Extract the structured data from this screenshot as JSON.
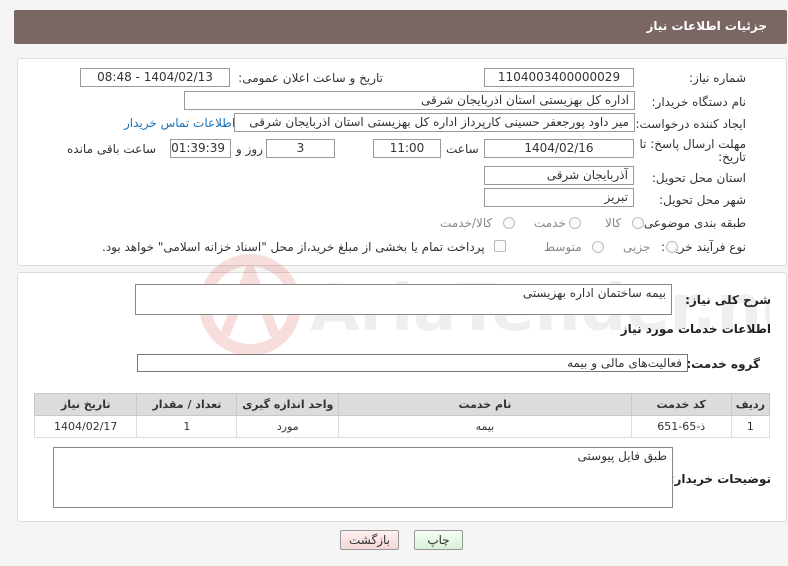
{
  "header": {
    "title": "جزئیات اطلاعات نیاز"
  },
  "form": {
    "need_number": {
      "label": "شماره نیاز:",
      "value": "1104003400000029"
    },
    "announce": {
      "label": "تاریخ و ساعت اعلان عمومی:",
      "value": "1404/02/13 - 08:48"
    },
    "buyer_org": {
      "label": "نام دستگاه خریدار:",
      "value": "اداره کل بهزیستی استان اذربایجان شرقی"
    },
    "requester": {
      "label": "ایجاد کننده درخواست:",
      "value": "میر داود پورجعفر حسینی کارپرداز اداره کل بهزیستی استان اذربایجان شرقی",
      "contact_link": "اطلاعات تماس خریدار"
    },
    "deadline": {
      "label_line1": "مهلت ارسال پاسخ: تا",
      "label_line2": "تاریخ:",
      "date": "1404/02/16",
      "time_label": "ساعت",
      "time": "11:00",
      "days": "3",
      "days_label": "روز و",
      "remaining": "01:39:39",
      "remaining_label": "ساعت باقی مانده"
    },
    "province": {
      "label": "استان محل تحویل:",
      "value": "آذربایجان شرقی"
    },
    "city": {
      "label": "شهر محل تحویل:",
      "value": "تبریز"
    },
    "category": {
      "label": "طبقه بندی موضوعی:",
      "options": [
        "کالا",
        "خدمت",
        "کالا/خدمت"
      ]
    },
    "process": {
      "label": "نوع فرآیند خرید :",
      "options": [
        "جزیی",
        "متوسط"
      ],
      "payment_note": "پرداخت تمام یا بخشی از مبلغ خرید،از محل \"اسناد خزانه اسلامی\" خواهد بود."
    }
  },
  "details": {
    "summary_label": "شرح کلی نیاز:",
    "summary": "بیمه ساختمان اداره بهزیستی",
    "services_heading": "اطلاعات خدمات مورد نیاز",
    "service_group_label": "گروه خدمت:",
    "service_group": "فعالیت‌های مالی و بیمه",
    "table": {
      "headers": [
        "ردیف",
        "کد خدمت",
        "نام خدمت",
        "واحد اندازه گیری",
        "تعداد / مقدار",
        "تاریخ نیاز"
      ],
      "rows": [
        [
          "1",
          "ذ-65-651",
          "بیمه",
          "مورد",
          "1",
          "1404/02/17"
        ]
      ]
    },
    "buyer_notes_label": "توضیحات خریدار:",
    "buyer_notes": "طبق فایل پیوستی"
  },
  "buttons": {
    "print": "چاپ",
    "back": "بازگشت"
  },
  "watermark_text": "AriaTender.net"
}
